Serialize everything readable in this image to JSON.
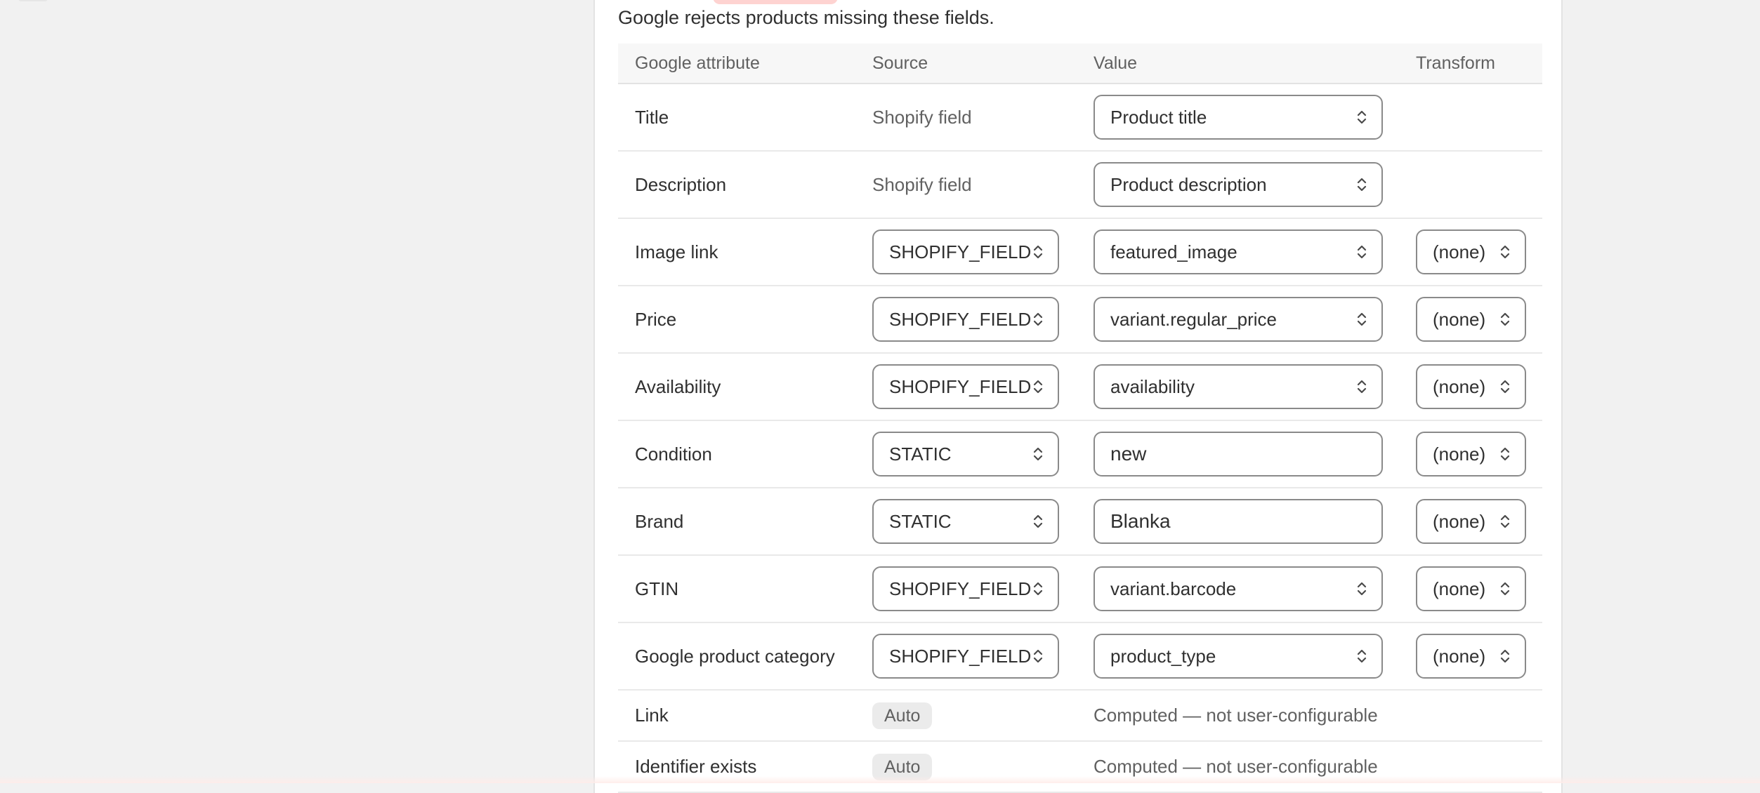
{
  "section": {
    "subtitle": "Google rejects products missing these fields."
  },
  "table": {
    "headers": {
      "attribute": "Google attribute",
      "source": "Source",
      "value": "Value",
      "transform": "Transform"
    },
    "rows": [
      {
        "attribute": "Title",
        "source_text": "Shopify field",
        "value_select": "Product title"
      },
      {
        "attribute": "Description",
        "source_text": "Shopify field",
        "value_select": "Product description"
      },
      {
        "attribute": "Image link",
        "source_select": "SHOPIFY_FIELD",
        "value_select": "featured_image",
        "transform": "(none)"
      },
      {
        "attribute": "Price",
        "source_select": "SHOPIFY_FIELD",
        "value_select": "variant.regular_price",
        "transform": "(none)"
      },
      {
        "attribute": "Availability",
        "source_select": "SHOPIFY_FIELD",
        "value_select": "availability",
        "transform": "(none)"
      },
      {
        "attribute": "Condition",
        "source_select": "STATIC",
        "value_input": "new",
        "transform": "(none)"
      },
      {
        "attribute": "Brand",
        "source_select": "STATIC",
        "value_input": "Blanka",
        "transform": "(none)"
      },
      {
        "attribute": "GTIN",
        "source_select": "SHOPIFY_FIELD",
        "value_select": "variant.barcode",
        "transform": "(none)"
      },
      {
        "attribute": "Google product category",
        "source_select": "SHOPIFY_FIELD",
        "value_select": "product_type",
        "transform": "(none)"
      },
      {
        "attribute": "Link",
        "source_badge": "Auto",
        "value_note": "Computed — not user-configurable"
      },
      {
        "attribute": "Identifier exists",
        "source_badge": "Auto",
        "value_note": "Computed — not user-configurable"
      }
    ]
  },
  "icons": {
    "select_chevrons": "chevron-up-down-icon"
  },
  "colors": {
    "required_badge": "#fed3d1",
    "card_background": "#ffffff",
    "page_background": "#f1f1f1"
  }
}
